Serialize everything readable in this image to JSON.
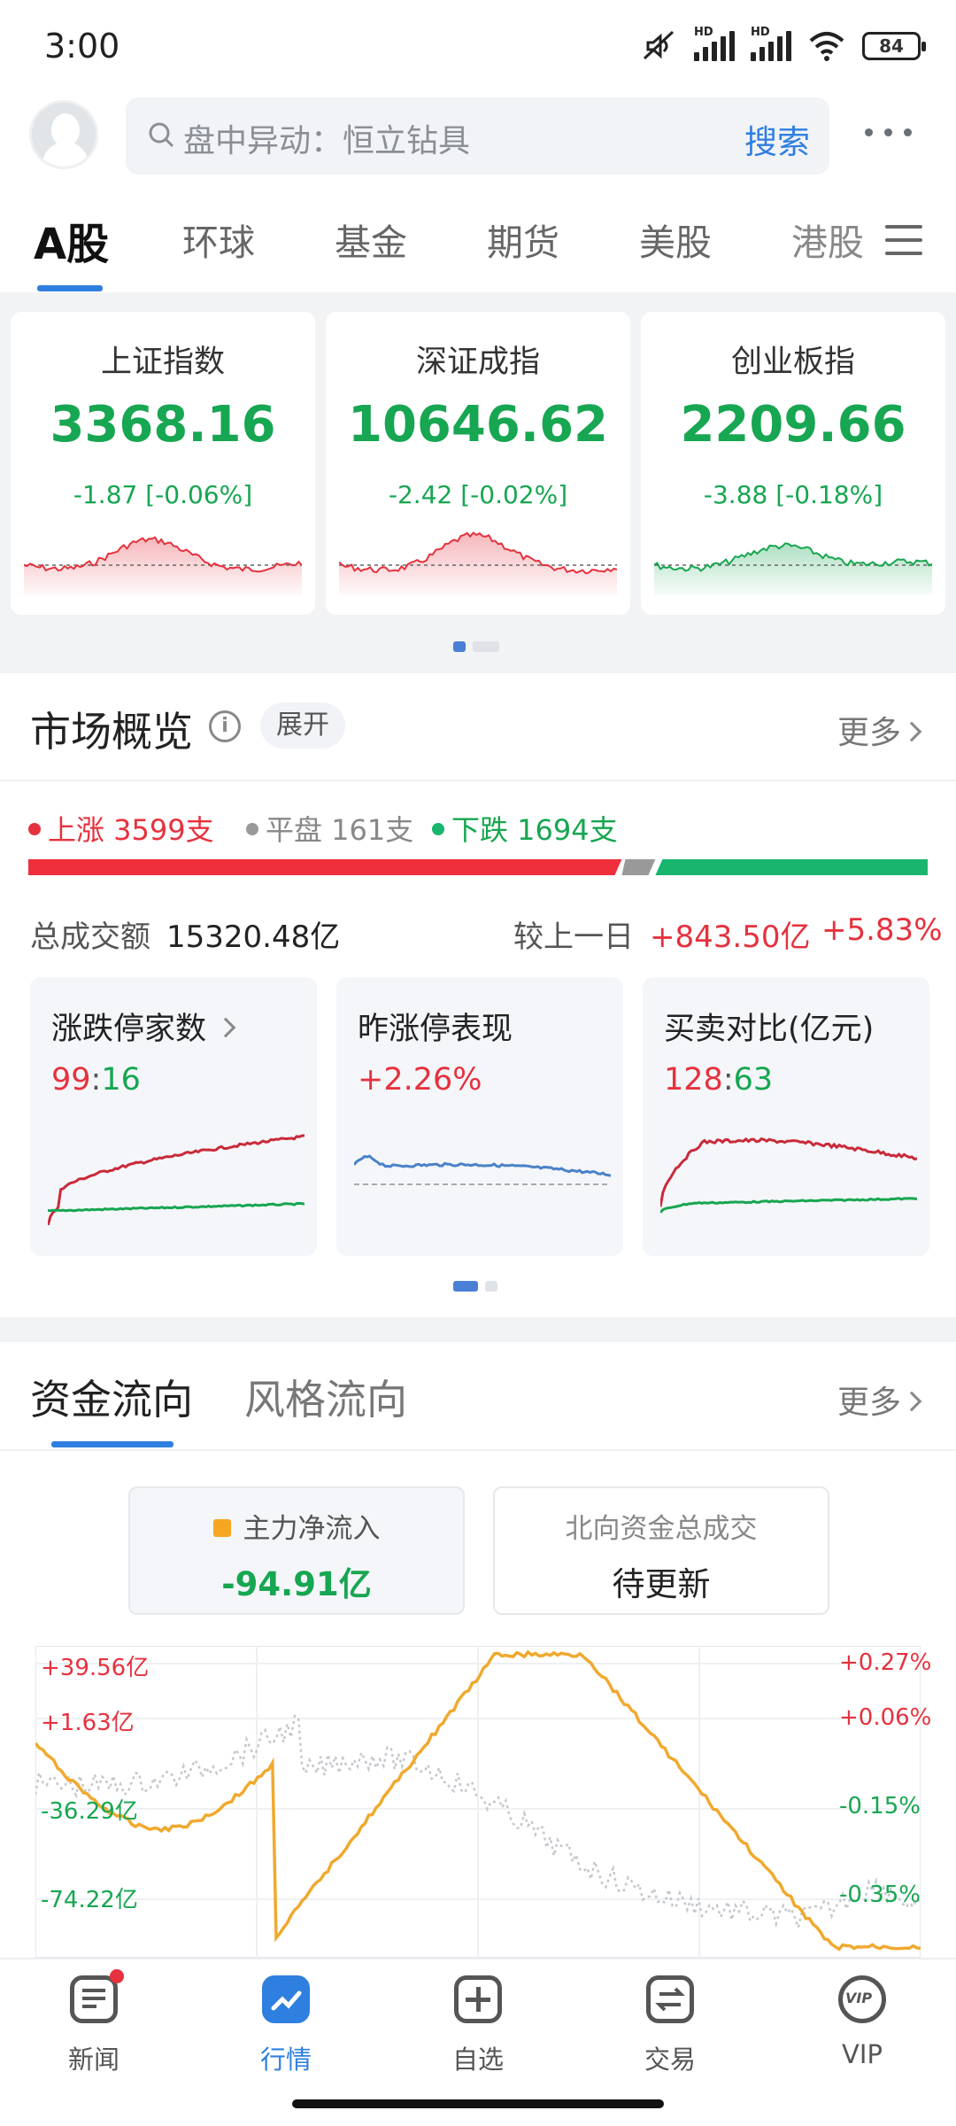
{
  "status_bar": {
    "time": "3:00",
    "hd1": "HD",
    "hd2": "HD",
    "battery": "84"
  },
  "search": {
    "placeholder": "盘中异动：恒立钻具",
    "button": "搜索"
  },
  "tabs": [
    {
      "label": "A股",
      "active": true
    },
    {
      "label": "环球"
    },
    {
      "label": "基金"
    },
    {
      "label": "期货"
    },
    {
      "label": "美股"
    },
    {
      "label": "港股"
    }
  ],
  "indices": [
    {
      "name": "上证指数",
      "value": "3368.16",
      "change": "-1.87 [-0.06%]"
    },
    {
      "name": "深证成指",
      "value": "10646.62",
      "change": "-2.42 [-0.02%]"
    },
    {
      "name": "创业板指",
      "value": "2209.66",
      "change": "-3.88 [-0.18%]"
    }
  ],
  "market_overview": {
    "title": "市场概览",
    "expand": "展开",
    "more": "更多",
    "rise": "上涨 3599支",
    "flat": "平盘 161支",
    "fall": "下跌 1694支",
    "rise_count": 3599,
    "flat_count": 161,
    "fall_count": 1694,
    "turnover_label": "总成交额",
    "turnover_value": "15320.48亿",
    "compare_label": "较上一日",
    "compare_value": "+843.50亿",
    "compare_pct": "+5.83%",
    "cards": [
      {
        "title": "涨跌停家数",
        "up": "99",
        "sep": ":",
        "down": "16"
      },
      {
        "title": "昨涨停表现",
        "value": "+2.26%"
      },
      {
        "title": "买卖对比(亿元)",
        "up": "128",
        "sep": ":",
        "down": "63"
      }
    ]
  },
  "capital_flow": {
    "tab_active": "资金流向",
    "tab_other": "风格流向",
    "more": "更多",
    "main_label": "主力净流入",
    "main_value": "-94.91亿",
    "north_label": "北向资金总成交",
    "north_value": "待更新",
    "y_left": [
      "+39.56亿",
      "+1.63亿",
      "-36.29亿",
      "-74.22亿"
    ],
    "y_right": [
      "+0.27%",
      "+0.06%",
      "-0.15%",
      "-0.35%"
    ]
  },
  "bottom_nav": [
    {
      "label": "新闻"
    },
    {
      "label": "行情",
      "active": true
    },
    {
      "label": "自选"
    },
    {
      "label": "交易"
    },
    {
      "label": "VIP"
    }
  ],
  "colors": {
    "up": "#e5323e",
    "down": "#17a651",
    "accent": "#2f7fe0",
    "orange": "#f5a623"
  }
}
